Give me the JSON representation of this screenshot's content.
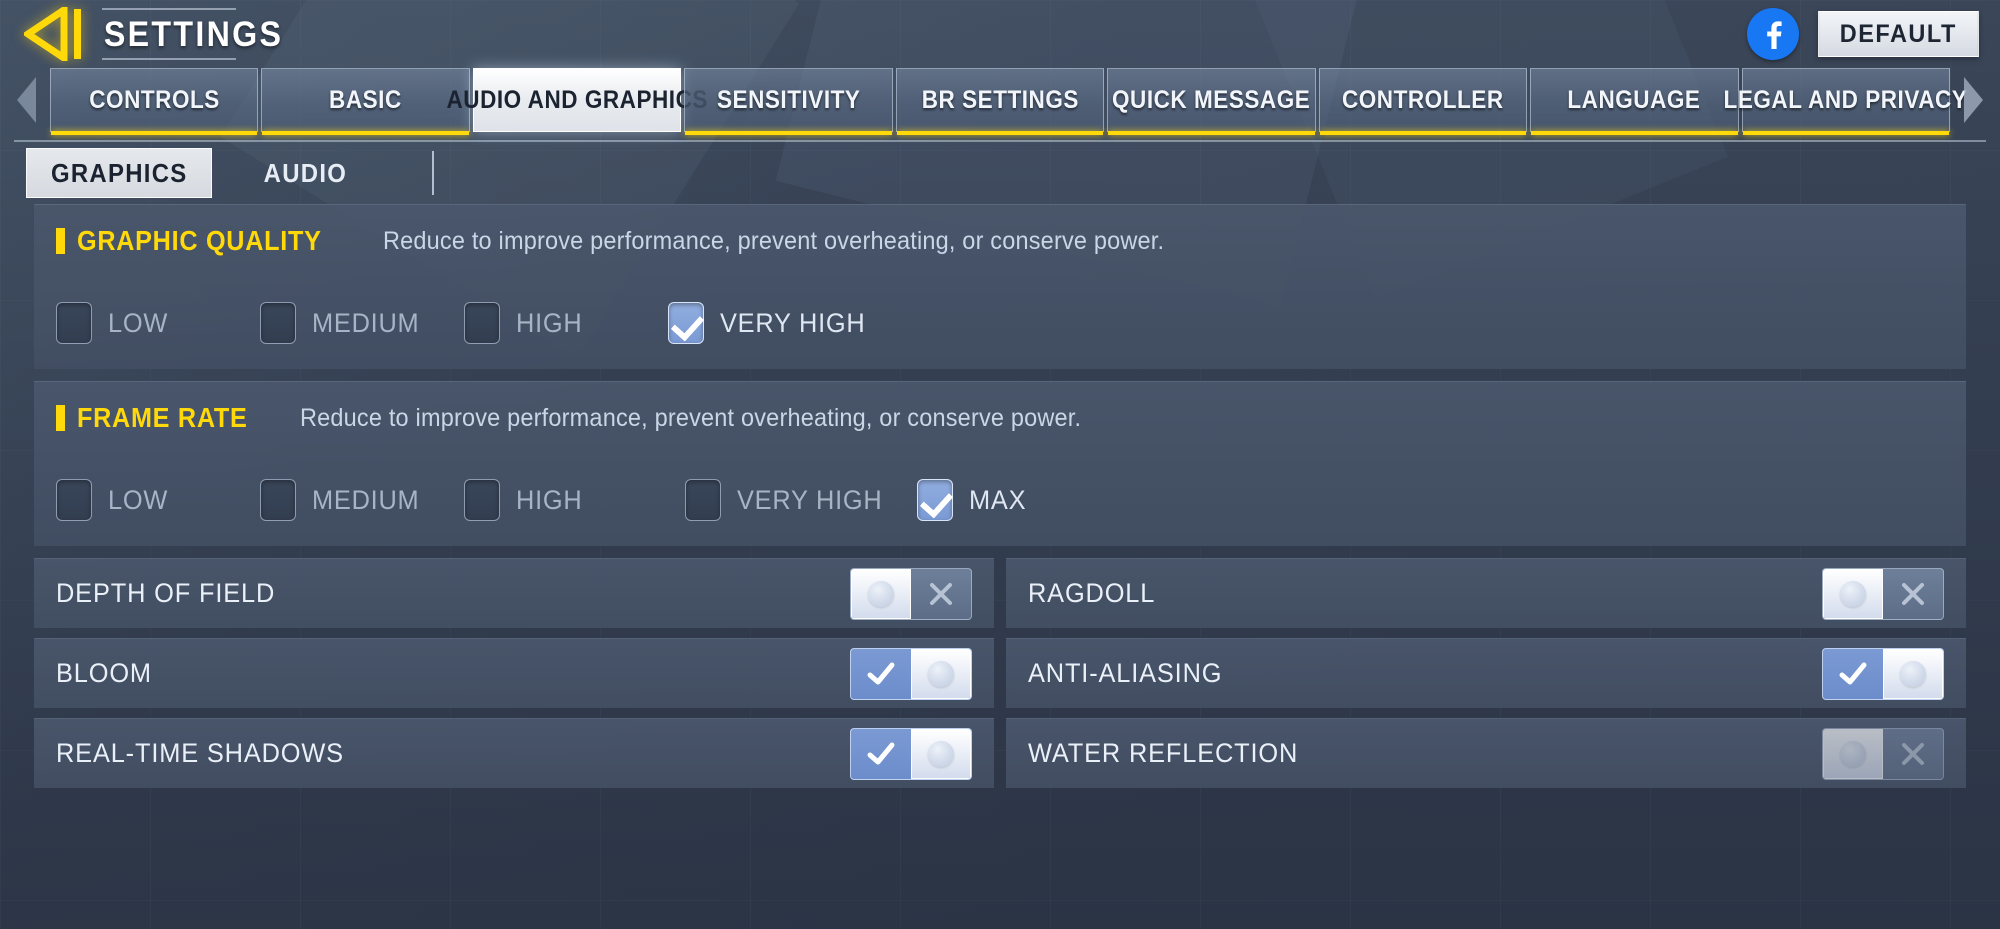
{
  "header": {
    "title": "SETTINGS",
    "back_icon": "back-arrow-icon",
    "facebook_icon": "facebook-icon",
    "default_label": "DEFAULT"
  },
  "tabbar": {
    "prev_icon": "chevron-left-icon",
    "next_icon": "chevron-right-icon",
    "tabs": [
      {
        "label": "CONTROLS",
        "active": false,
        "underline": true
      },
      {
        "label": "BASIC",
        "active": false,
        "underline": true
      },
      {
        "label": "AUDIO AND GRAPHICS",
        "active": true,
        "underline": false
      },
      {
        "label": "SENSITIVITY",
        "active": false,
        "underline": true
      },
      {
        "label": "BR SETTINGS",
        "active": false,
        "underline": true
      },
      {
        "label": "QUICK MESSAGE",
        "active": false,
        "underline": true
      },
      {
        "label": "CONTROLLER",
        "active": false,
        "underline": true
      },
      {
        "label": "LANGUAGE",
        "active": false,
        "underline": true
      },
      {
        "label": "LEGAL AND PRIVACY",
        "active": false,
        "underline": true
      }
    ]
  },
  "subtabs": [
    {
      "label": "GRAPHICS",
      "active": true
    },
    {
      "label": "AUDIO",
      "active": false
    }
  ],
  "sections": [
    {
      "title": "GRAPHIC QUALITY",
      "description": "Reduce to improve performance, prevent overheating, or conserve power.",
      "options": [
        {
          "label": "LOW",
          "checked": false,
          "dim": true
        },
        {
          "label": "MEDIUM",
          "checked": false,
          "dim": true
        },
        {
          "label": "HIGH",
          "checked": false,
          "dim": true
        },
        {
          "label": "VERY HIGH",
          "checked": true,
          "dim": false
        }
      ]
    },
    {
      "title": "FRAME RATE",
      "description": "Reduce to improve performance, prevent overheating, or conserve power.",
      "options": [
        {
          "label": "LOW",
          "checked": false,
          "dim": true
        },
        {
          "label": "MEDIUM",
          "checked": false,
          "dim": true
        },
        {
          "label": "HIGH",
          "checked": false,
          "dim": true
        },
        {
          "label": "VERY HIGH",
          "checked": false,
          "dim": true
        },
        {
          "label": "MAX",
          "checked": true,
          "dim": false
        }
      ]
    }
  ],
  "toggles": [
    {
      "label": "DEPTH OF FIELD",
      "on": false,
      "disabled": false
    },
    {
      "label": "RAGDOLL",
      "on": false,
      "disabled": false
    },
    {
      "label": "BLOOM",
      "on": true,
      "disabled": false
    },
    {
      "label": "ANTI-ALIASING",
      "on": true,
      "disabled": false
    },
    {
      "label": "REAL-TIME SHADOWS",
      "on": true,
      "disabled": false
    },
    {
      "label": "WATER REFLECTION",
      "on": false,
      "disabled": true
    }
  ],
  "colors": {
    "accent_yellow": "#ffd90a",
    "toggle_on_blue": "#7b9ad4",
    "checkbox_blue": "#8aa6dc",
    "facebook_blue": "#1877f2",
    "panel_bg": "#4a576c",
    "page_bg": "#333e50"
  }
}
